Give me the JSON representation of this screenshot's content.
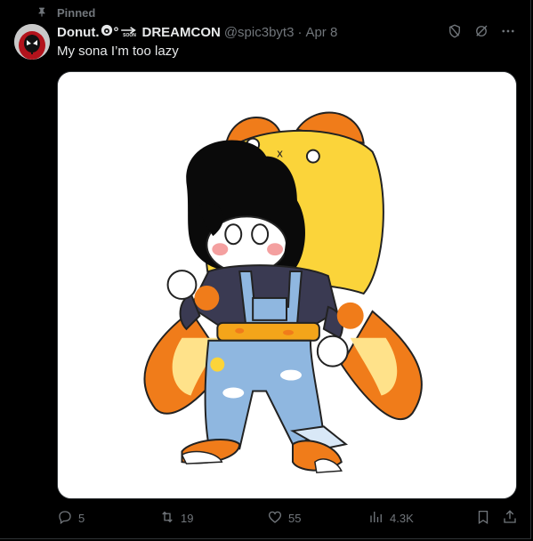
{
  "pinned": {
    "label": "Pinned",
    "icon": "pin-icon"
  },
  "author": {
    "display_name": "Donut.",
    "decorations": [
      "°",
      "SOON"
    ],
    "display_name_suffix": "DREAMCON",
    "handle": "@spic3byt3",
    "separator": "·",
    "date": "Apr 8"
  },
  "tweet": {
    "text": "My sona I’m too lazy"
  },
  "actions": {
    "replies": "5",
    "reposts": "19",
    "likes": "55",
    "views": "4.3K"
  },
  "icons": {
    "top": [
      "shield-icon",
      "grok-icon",
      "more-icon"
    ],
    "bottom": [
      "reply-icon",
      "repost-icon",
      "like-icon",
      "views-icon",
      "bookmark-icon",
      "share-icon"
    ]
  },
  "colors": {
    "background": "#000000",
    "text_primary": "#e7e9ea",
    "text_secondary": "#71767b",
    "border": "#2f3336"
  }
}
